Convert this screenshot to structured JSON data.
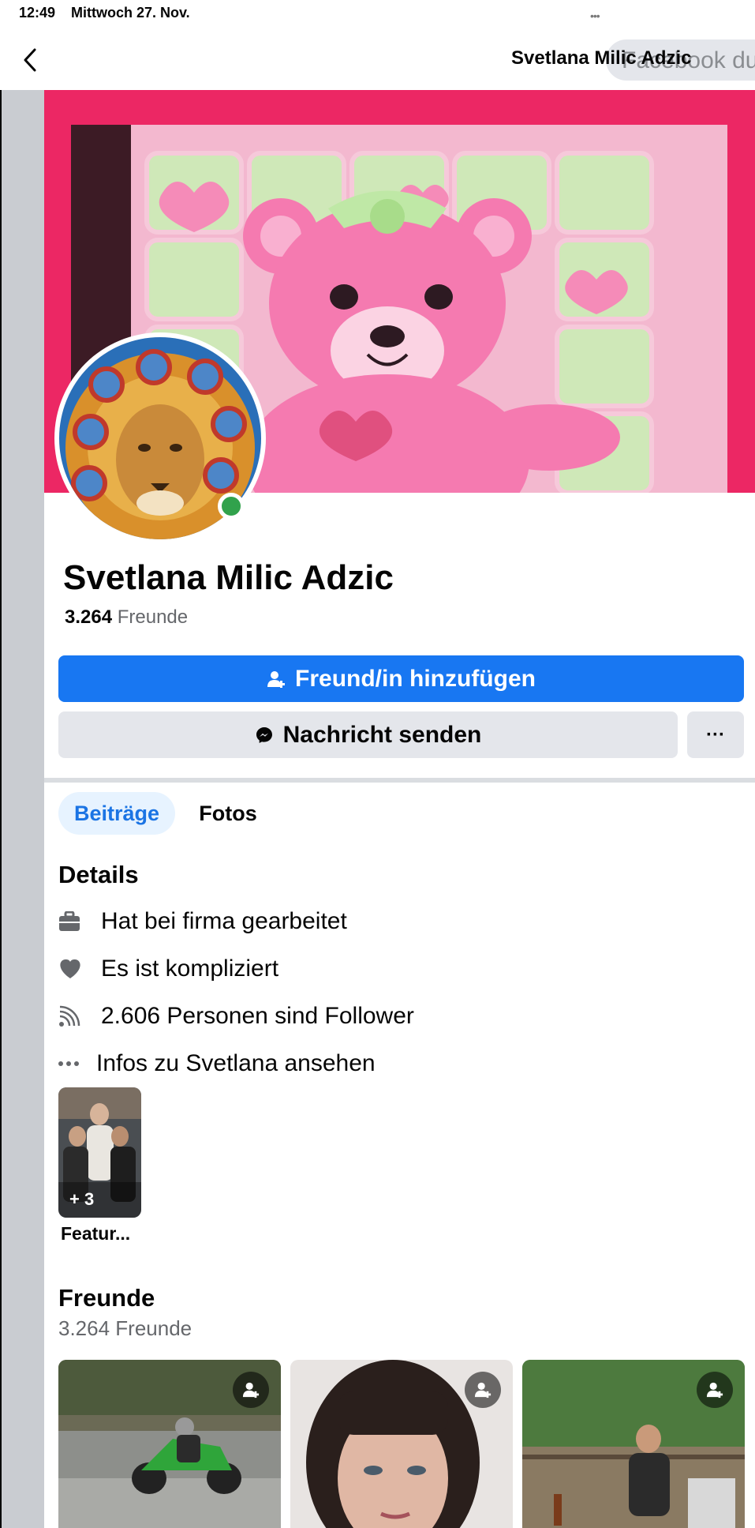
{
  "status": {
    "time": "12:49",
    "date": "Mittwoch 27. Nov.",
    "dots": "•••"
  },
  "nav": {
    "title": "Svetlana Milic Adzic",
    "search_placeholder": "Facebook du"
  },
  "profile": {
    "name": "Svetlana Milic Adzic",
    "friends_count": "3.264",
    "friends_label": "Freunde"
  },
  "actions": {
    "add_friend": "Freund/in hinzufügen",
    "send_message": "Nachricht senden",
    "more": "···"
  },
  "tabs": [
    {
      "label": "Beiträge",
      "active": true
    },
    {
      "label": "Fotos",
      "active": false
    }
  ],
  "details": {
    "title": "Details",
    "items": [
      {
        "icon": "briefcase-icon",
        "text": "Hat bei firma gearbeitet"
      },
      {
        "icon": "heart-icon",
        "text": "Es ist kompliziert"
      },
      {
        "icon": "rss-icon",
        "text": "2.606 Personen sind Follower"
      },
      {
        "icon": "more-dots-icon",
        "text": "Infos zu Svetlana ansehen"
      }
    ]
  },
  "featured": {
    "count": "+ 3",
    "label": "Featur..."
  },
  "friends": {
    "title": "Freunde",
    "subtitle": "3.264 Freunde"
  },
  "colors": {
    "brand_blue": "#1877f2",
    "online": "#31a24c",
    "cover_pink": "#ec2764"
  }
}
